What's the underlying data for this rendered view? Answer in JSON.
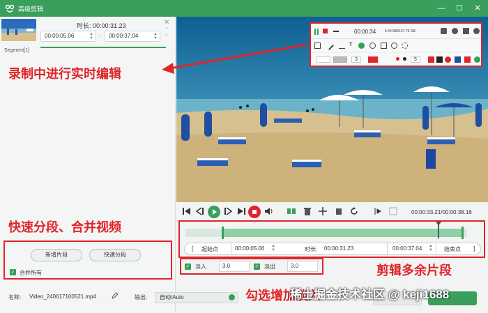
{
  "window": {
    "title": "高级剪辑",
    "minimize": "—",
    "maximize": "☐",
    "close": "✕"
  },
  "segment": {
    "label": "Segment[1]",
    "duration_label": "时长:",
    "duration_value": "00:00:31.23",
    "start": "00:00:05.06",
    "separator": "-",
    "end": "00:00:37.04"
  },
  "captions": {
    "realtime": "录制中进行实时编辑",
    "split_merge": "快速分段、合并视频",
    "cut": "剪辑多余片段",
    "fade": "勾选增加淡入"
  },
  "split": {
    "new_segment": "新增片段",
    "quick_split": "快速分段",
    "merge_all": "合并所有"
  },
  "file": {
    "name_label": "名称:",
    "name": "Video_240617100521.mp4",
    "output_label": "输出:",
    "output_value": "自动/Auto"
  },
  "toolbar": {
    "rec_time": "00:00:34",
    "rec_size": "5.44 MB/107.79 GB",
    "pen_size": "3",
    "brush_size": "5"
  },
  "playback": {
    "time": "00:00:33.21/00:00:38.16"
  },
  "timeline": {
    "start_btn": "起始点",
    "start_bracket": "[",
    "start_value": "00:00:05.06",
    "duration_label": "时长:",
    "duration_value": "00:00:31.23",
    "end_value": "00:00:37.04",
    "end_btn": "结束点",
    "end_bracket": "]"
  },
  "fade": {
    "fade_in_label": "淡入",
    "fade_in_value": "3.0",
    "fade_out_label": "淡出",
    "fade_out_value": "3.0"
  },
  "watermark": "稀土掘金技术社区 @ keji1688",
  "colors": {
    "accent": "#3a9e5c",
    "annotation": "#e0242a",
    "titlebar": "#3a9e5c"
  }
}
